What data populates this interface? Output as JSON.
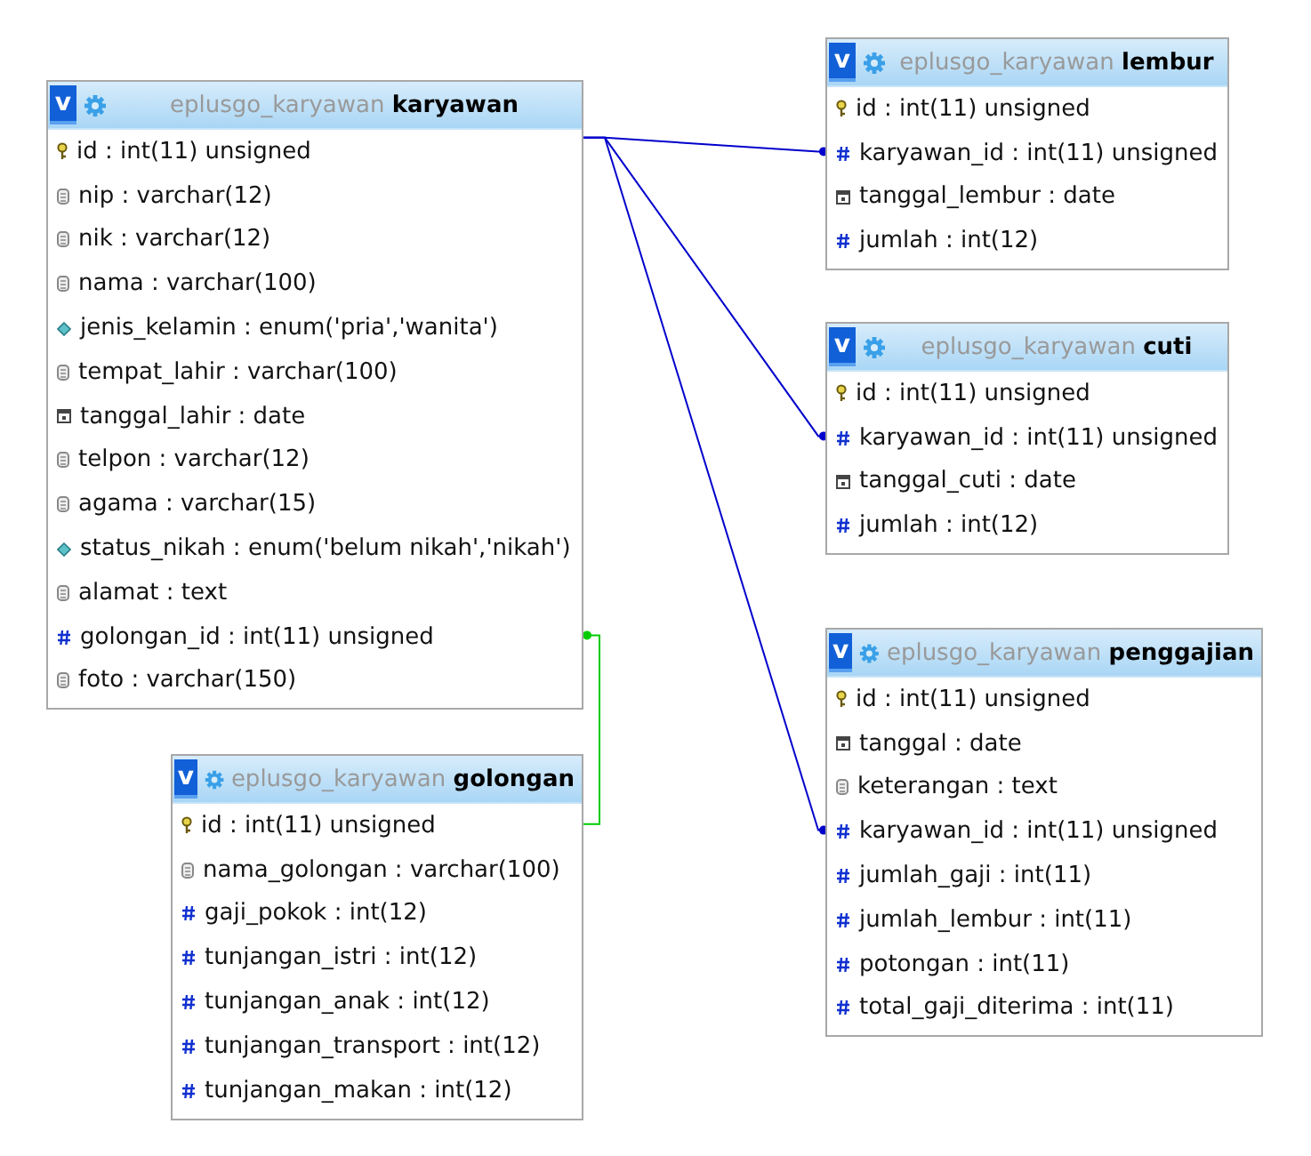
{
  "tables": [
    {
      "toggle": "v",
      "database": "eplusgo_karyawan",
      "name": "karyawan",
      "columns": [
        {
          "kind": "key",
          "text": "id : int(11) unsigned"
        },
        {
          "kind": "text",
          "text": "nip : varchar(12)"
        },
        {
          "kind": "text",
          "text": "nik : varchar(12)"
        },
        {
          "kind": "text",
          "text": "nama : varchar(100)"
        },
        {
          "kind": "enum",
          "text": "jenis_kelamin : enum('pria','wanita')"
        },
        {
          "kind": "text",
          "text": "tempat_lahir : varchar(100)"
        },
        {
          "kind": "date",
          "text": "tanggal_lahir : date"
        },
        {
          "kind": "text",
          "text": "telpon : varchar(12)"
        },
        {
          "kind": "text",
          "text": "agama : varchar(15)"
        },
        {
          "kind": "enum",
          "text": "status_nikah : enum('belum nikah','nikah')"
        },
        {
          "kind": "text",
          "text": "alamat : text"
        },
        {
          "kind": "number",
          "text": "golongan_id : int(11) unsigned",
          "color": "#00cc00"
        },
        {
          "kind": "text",
          "text": "foto : varchar(150)"
        }
      ]
    },
    {
      "toggle": "v",
      "database": "eplusgo_karyawan",
      "name": "lembur",
      "columns": [
        {
          "kind": "key",
          "text": "id : int(11) unsigned"
        },
        {
          "kind": "number",
          "text": "karyawan_id : int(11) unsigned",
          "color": "#0000cc"
        },
        {
          "kind": "date",
          "text": "tanggal_lembur : date"
        },
        {
          "kind": "number",
          "text": "jumlah : int(12)"
        }
      ]
    },
    {
      "toggle": "v",
      "database": "eplusgo_karyawan",
      "name": "cuti",
      "columns": [
        {
          "kind": "key",
          "text": "id : int(11) unsigned"
        },
        {
          "kind": "number",
          "text": "karyawan_id : int(11) unsigned",
          "color": "#0000cc"
        },
        {
          "kind": "date",
          "text": "tanggal_cuti : date"
        },
        {
          "kind": "number",
          "text": "jumlah : int(12)"
        }
      ]
    },
    {
      "toggle": "v",
      "database": "eplusgo_karyawan",
      "name": "penggajian",
      "columns": [
        {
          "kind": "key",
          "text": "id : int(11) unsigned"
        },
        {
          "kind": "date",
          "text": "tanggal : date"
        },
        {
          "kind": "text",
          "text": "keterangan : text"
        },
        {
          "kind": "number",
          "text": "karyawan_id : int(11) unsigned",
          "color": "#0000cc"
        },
        {
          "kind": "number",
          "text": "jumlah_gaji : int(11)"
        },
        {
          "kind": "number",
          "text": "jumlah_lembur : int(11)"
        },
        {
          "kind": "number",
          "text": "potongan : int(11)"
        },
        {
          "kind": "number",
          "text": "total_gaji_diterima : int(11)"
        }
      ]
    },
    {
      "toggle": "v",
      "database": "eplusgo_karyawan",
      "name": "golongan",
      "columns": [
        {
          "kind": "key",
          "text": "id : int(11) unsigned"
        },
        {
          "kind": "text",
          "text": "nama_golongan : varchar(100)"
        },
        {
          "kind": "number",
          "text": "gaji_pokok : int(12)"
        },
        {
          "kind": "number",
          "text": "tunjangan_istri : int(12)"
        },
        {
          "kind": "number",
          "text": "tunjangan_anak : int(12)"
        },
        {
          "kind": "number",
          "text": "tunjangan_transport : int(12)"
        },
        {
          "kind": "number",
          "text": "tunjangan_makan : int(12)"
        }
      ]
    }
  ]
}
